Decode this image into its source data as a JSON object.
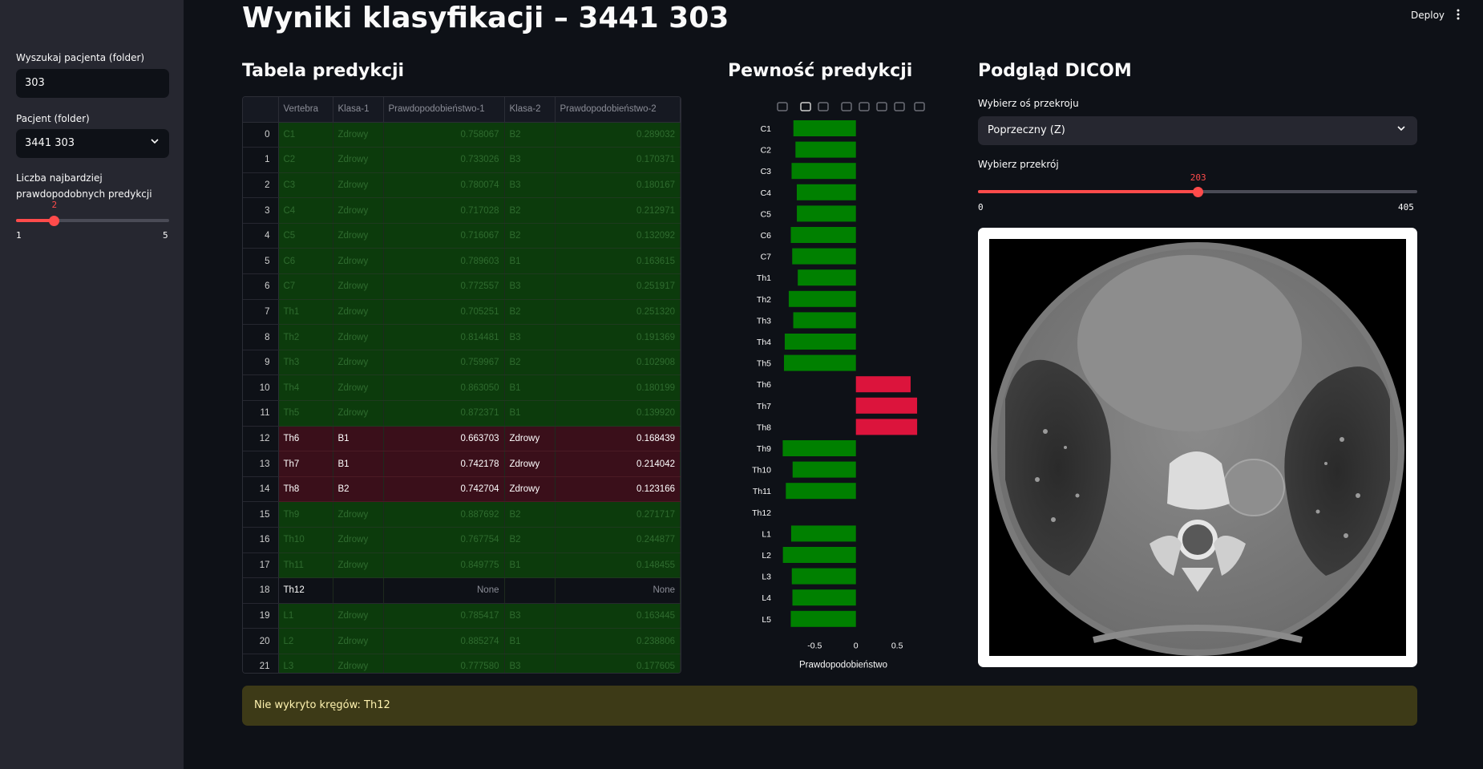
{
  "app": {
    "title": "Wyniki klasyfikacji – 3441 303",
    "deploy_label": "Deploy",
    "menu_icon": "kebab-icon"
  },
  "sidebar": {
    "search_label": "Wyszukaj pacjenta (folder)",
    "search_value": "303",
    "patient_label": "Pacjent (folder)",
    "patient_value": "3441 303",
    "topk_label_1": "Liczba najbardziej",
    "topk_label_2": "prawdopodobnych predykcji",
    "topk_value": "2",
    "topk_min": "1",
    "topk_max": "5",
    "topk_fraction": 0.25
  },
  "sections": {
    "table": "Tabela predykcji",
    "chart": "Pewność predykcji",
    "dicom": "Podgląd DICOM"
  },
  "table": {
    "headers": [
      "",
      "Vertebra",
      "Klasa-1",
      "Prawdopodobieństwo-1",
      "Klasa-2",
      "Prawdopodobieństwo-2"
    ],
    "rows": [
      {
        "i": "0",
        "v": "C1",
        "k1": "Zdrowy",
        "p1": "0.758067",
        "k2": "B2",
        "p2": "0.289032",
        "s": "ok"
      },
      {
        "i": "1",
        "v": "C2",
        "k1": "Zdrowy",
        "p1": "0.733026",
        "k2": "B3",
        "p2": "0.170371",
        "s": "ok"
      },
      {
        "i": "2",
        "v": "C3",
        "k1": "Zdrowy",
        "p1": "0.780074",
        "k2": "B3",
        "p2": "0.180167",
        "s": "ok"
      },
      {
        "i": "3",
        "v": "C4",
        "k1": "Zdrowy",
        "p1": "0.717028",
        "k2": "B2",
        "p2": "0.212971",
        "s": "ok"
      },
      {
        "i": "4",
        "v": "C5",
        "k1": "Zdrowy",
        "p1": "0.716067",
        "k2": "B2",
        "p2": "0.132092",
        "s": "ok"
      },
      {
        "i": "5",
        "v": "C6",
        "k1": "Zdrowy",
        "p1": "0.789603",
        "k2": "B1",
        "p2": "0.163615",
        "s": "ok"
      },
      {
        "i": "6",
        "v": "C7",
        "k1": "Zdrowy",
        "p1": "0.772557",
        "k2": "B3",
        "p2": "0.251917",
        "s": "ok"
      },
      {
        "i": "7",
        "v": "Th1",
        "k1": "Zdrowy",
        "p1": "0.705251",
        "k2": "B2",
        "p2": "0.251320",
        "s": "ok"
      },
      {
        "i": "8",
        "v": "Th2",
        "k1": "Zdrowy",
        "p1": "0.814481",
        "k2": "B3",
        "p2": "0.191369",
        "s": "ok"
      },
      {
        "i": "9",
        "v": "Th3",
        "k1": "Zdrowy",
        "p1": "0.759967",
        "k2": "B2",
        "p2": "0.102908",
        "s": "ok"
      },
      {
        "i": "10",
        "v": "Th4",
        "k1": "Zdrowy",
        "p1": "0.863050",
        "k2": "B1",
        "p2": "0.180199",
        "s": "ok"
      },
      {
        "i": "11",
        "v": "Th5",
        "k1": "Zdrowy",
        "p1": "0.872371",
        "k2": "B1",
        "p2": "0.139920",
        "s": "ok"
      },
      {
        "i": "12",
        "v": "Th6",
        "k1": "B1",
        "p1": "0.663703",
        "k2": "Zdrowy",
        "p2": "0.168439",
        "s": "bad"
      },
      {
        "i": "13",
        "v": "Th7",
        "k1": "B1",
        "p1": "0.742178",
        "k2": "Zdrowy",
        "p2": "0.214042",
        "s": "bad"
      },
      {
        "i": "14",
        "v": "Th8",
        "k1": "B2",
        "p1": "0.742704",
        "k2": "Zdrowy",
        "p2": "0.123166",
        "s": "bad"
      },
      {
        "i": "15",
        "v": "Th9",
        "k1": "Zdrowy",
        "p1": "0.887692",
        "k2": "B2",
        "p2": "0.271717",
        "s": "ok"
      },
      {
        "i": "16",
        "v": "Th10",
        "k1": "Zdrowy",
        "p1": "0.767754",
        "k2": "B2",
        "p2": "0.244877",
        "s": "ok"
      },
      {
        "i": "17",
        "v": "Th11",
        "k1": "Zdrowy",
        "p1": "0.849775",
        "k2": "B1",
        "p2": "0.148455",
        "s": "ok"
      },
      {
        "i": "18",
        "v": "Th12",
        "k1": "",
        "p1": "None",
        "k2": "",
        "p2": "None",
        "s": "none"
      },
      {
        "i": "19",
        "v": "L1",
        "k1": "Zdrowy",
        "p1": "0.785417",
        "k2": "B3",
        "p2": "0.163445",
        "s": "ok"
      },
      {
        "i": "20",
        "v": "L2",
        "k1": "Zdrowy",
        "p1": "0.885274",
        "k2": "B1",
        "p2": "0.238806",
        "s": "ok"
      },
      {
        "i": "21",
        "v": "L3",
        "k1": "Zdrowy",
        "p1": "0.777580",
        "k2": "B3",
        "p2": "0.177605",
        "s": "ok"
      }
    ]
  },
  "chart_data": {
    "type": "bar",
    "orientation": "horizontal",
    "categories": [
      "C1",
      "C2",
      "C3",
      "C4",
      "C5",
      "C6",
      "C7",
      "Th1",
      "Th2",
      "Th3",
      "Th4",
      "Th5",
      "Th6",
      "Th7",
      "Th8",
      "Th9",
      "Th10",
      "Th11",
      "Th12",
      "L1",
      "L2",
      "L3",
      "L4",
      "L5"
    ],
    "values": [
      -0.758067,
      -0.733026,
      -0.780074,
      -0.717028,
      -0.716067,
      -0.789603,
      -0.772557,
      -0.705251,
      -0.814481,
      -0.759967,
      -0.86305,
      -0.872371,
      0.663703,
      0.742178,
      0.742704,
      -0.887692,
      -0.767754,
      -0.849775,
      null,
      -0.785417,
      -0.885274,
      -0.77758,
      -0.77,
      -0.79
    ],
    "xlabel": "Prawdopodobieństwo",
    "ylabel": "",
    "xlim": [
      -0.95,
      0.8
    ],
    "xticks": [
      "-0.5",
      "0",
      "0.5"
    ],
    "xtick_values": [
      -0.5,
      0,
      0.5
    ],
    "colors": {
      "healthy": "#008000",
      "fracture": "#dc143c"
    },
    "grid": false,
    "toolbar_icons": [
      "camera-icon",
      "zoom-icon",
      "pan-icon",
      "zoom-in-icon",
      "zoom-out-icon",
      "autoscale-icon",
      "home-icon",
      "fullscreen-icon"
    ]
  },
  "dicom": {
    "axis_label": "Wybierz oś przekroju",
    "axis_value": "Poprzeczny (Z)",
    "slice_label": "Wybierz przekrój",
    "slice_value": "203",
    "slice_min": "0",
    "slice_max": "405",
    "slice_fraction": 0.5012
  },
  "warning": {
    "text": "Nie wykryto kręgów: Th12"
  }
}
